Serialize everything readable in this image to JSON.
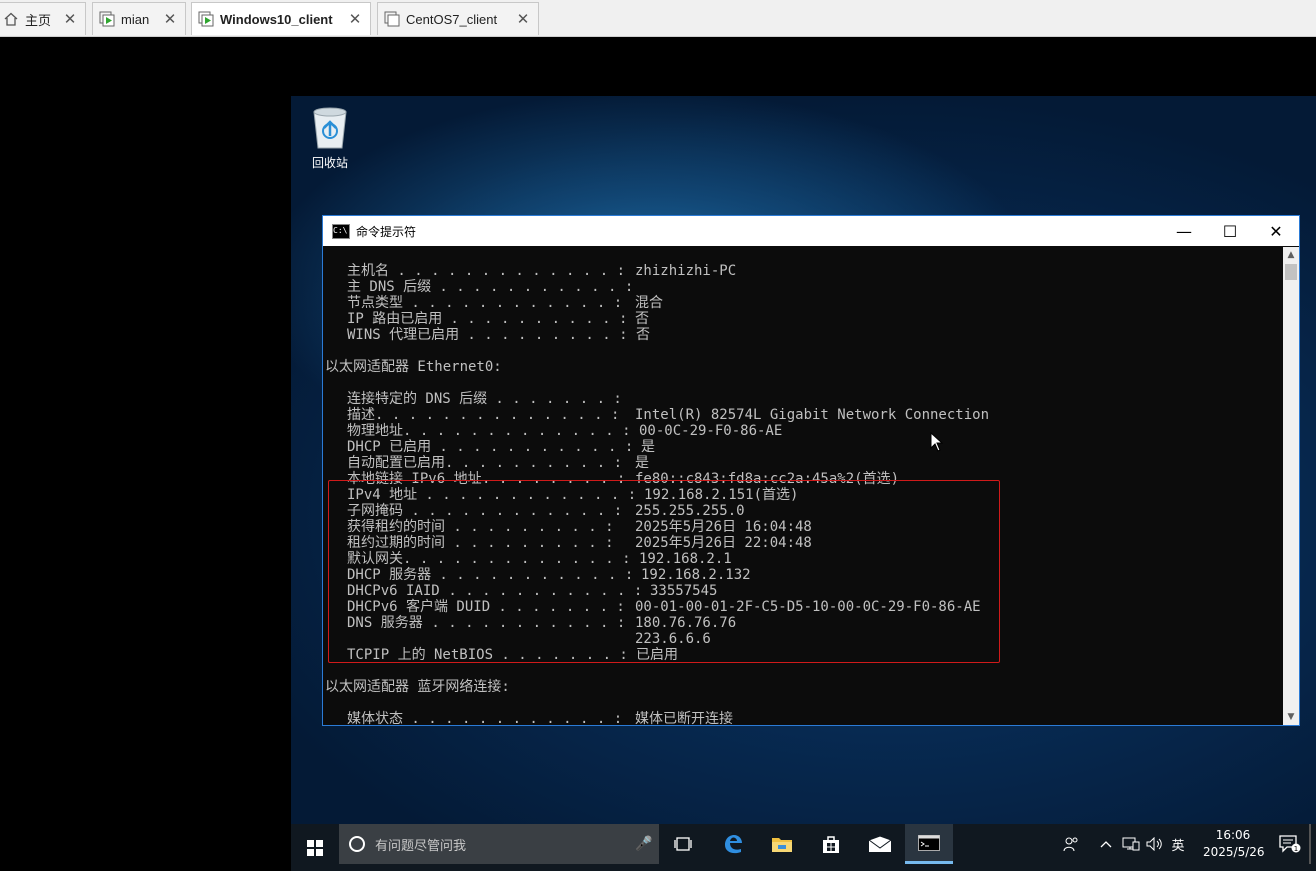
{
  "tabs": [
    {
      "label": "主页",
      "icon": "home-icon",
      "active": false
    },
    {
      "label": "mian",
      "icon": "vm-running-icon",
      "active": false
    },
    {
      "label": "Windows10_client",
      "icon": "vm-running-icon",
      "active": true
    },
    {
      "label": "CentOS7_client",
      "icon": "vm-stopped-icon",
      "active": false
    }
  ],
  "desktop": {
    "recycle_bin_label": "回收站"
  },
  "cmd": {
    "title": "命令提示符",
    "lines": [
      {
        "key": "主机名",
        "dots": " . . . . . . . . . . . . . :",
        "value": "zhizhizhi-PC"
      },
      {
        "key": "主 DNS 后缀",
        "dots": " . . . . . . . . . . . :",
        "value": ""
      },
      {
        "key": "节点类型",
        "dots": " . . . . . . . . . . . . :",
        "value": "混合"
      },
      {
        "key": "IP 路由已启用",
        "dots": " . . . . . . . . . . :",
        "value": "否"
      },
      {
        "key": "WINS 代理已启用",
        "dots": " . . . . . . . . . :",
        "value": "否"
      },
      {
        "header": "以太网适配器 Ethernet0:"
      },
      {
        "key": "连接特定的 DNS 后缀",
        "dots": " . . . . . . . :",
        "value": ""
      },
      {
        "key": "描述",
        "dots": ". . . . . . . . . . . . . . :",
        "value": "Intel(R) 82574L Gigabit Network Connection"
      },
      {
        "key": "物理地址",
        "dots": ". . . . . . . . . . . . . :",
        "value": "00-0C-29-F0-86-AE"
      },
      {
        "key": "DHCP 已启用",
        "dots": " . . . . . . . . . . . :",
        "value": "是"
      },
      {
        "key": "自动配置已启用",
        "dots": ". . . . . . . . . . :",
        "value": "是"
      },
      {
        "key": "本地链接 IPv6 地址",
        "dots": ". . . . . . . . :",
        "value": "fe80::c843:fd8a:cc2a:45a%2(首选)"
      },
      {
        "key": "IPv4 地址",
        "dots": " . . . . . . . . . . . . :",
        "value": "192.168.2.151(首选)"
      },
      {
        "key": "子网掩码",
        "dots": " . . . . . . . . . . . . :",
        "value": "255.255.255.0"
      },
      {
        "key": "获得租约的时间",
        "dots": " . . . . . . . . . :",
        "value": "2025年5月26日 16:04:48"
      },
      {
        "key": "租约过期的时间",
        "dots": " . . . . . . . . . :",
        "value": "2025年5月26日 22:04:48"
      },
      {
        "key": "默认网关",
        "dots": ". . . . . . . . . . . . . :",
        "value": "192.168.2.1"
      },
      {
        "key": "DHCP 服务器",
        "dots": " . . . . . . . . . . . :",
        "value": "192.168.2.132"
      },
      {
        "key": "DHCPv6 IAID",
        "dots": " . . . . . . . . . . . :",
        "value": "33557545"
      },
      {
        "key": "DHCPv6 客户端 DUID",
        "dots": " . . . . . . . :",
        "value": "00-01-00-01-2F-C5-D5-10-00-0C-29-F0-86-AE"
      },
      {
        "key": "DNS 服务器",
        "dots": " . . . . . . . . . . . :",
        "value": "180.76.76.76"
      },
      {
        "key": "",
        "dots": "",
        "value": "223.6.6.6"
      },
      {
        "key": "TCPIP 上的 NetBIOS",
        "dots": " . . . . . . . :",
        "value": "已启用"
      },
      {
        "header": "以太网适配器 蓝牙网络连接:"
      },
      {
        "key": "媒体状态",
        "dots": " . . . . . . . . . . . . :",
        "value": "媒体已断开连接"
      }
    ]
  },
  "taskbar": {
    "search_placeholder": "有问题尽管问我",
    "ime": "英",
    "time": "16:06",
    "date": "2025/5/26",
    "notification_count": "1"
  }
}
